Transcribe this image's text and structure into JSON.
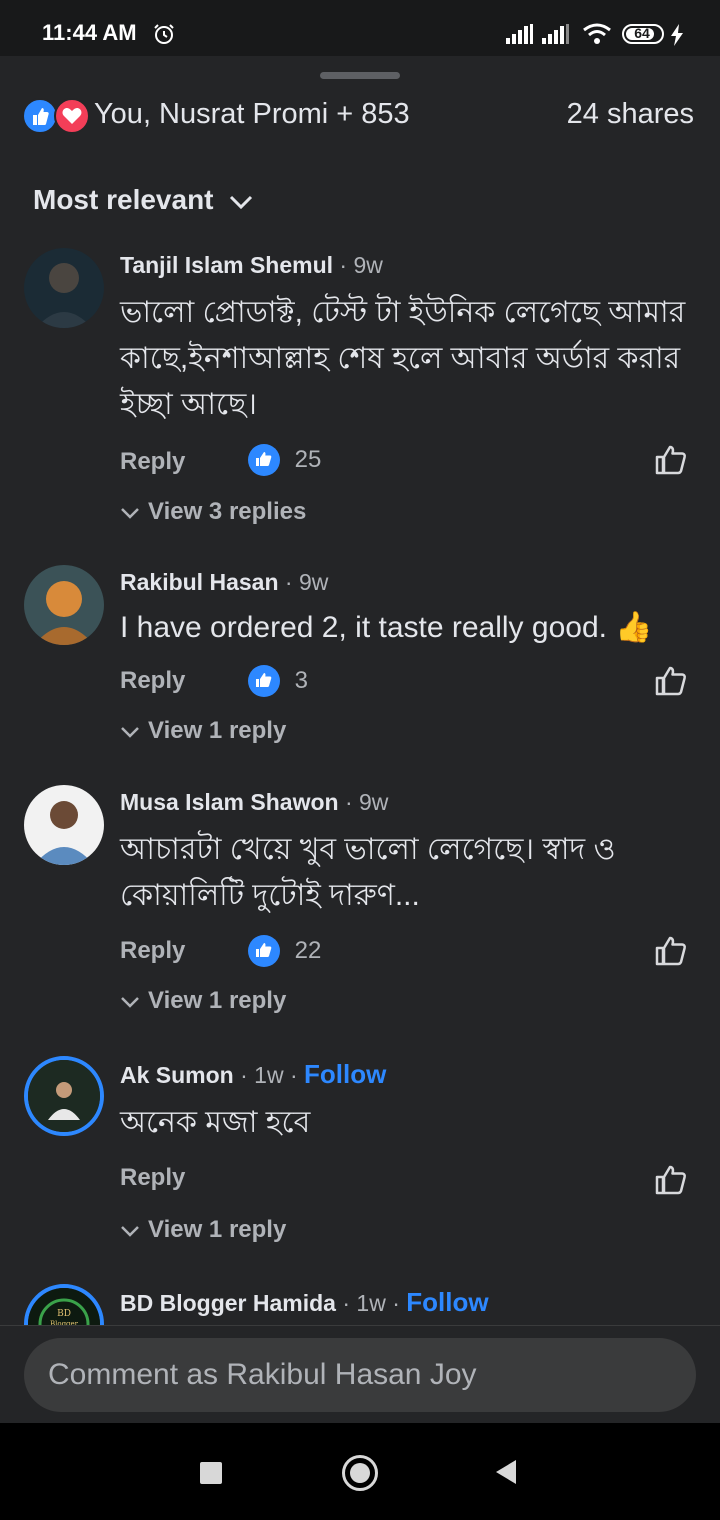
{
  "status_bar": {
    "time": "11:44 AM",
    "battery": "64",
    "icons": [
      "alarm-icon",
      "signal-icon",
      "signal-icon",
      "wifi-icon",
      "battery-icon",
      "charging-icon"
    ]
  },
  "reactions": {
    "text": "You, Nusrat Promi + 853",
    "shares": "24 shares",
    "icons": [
      "like-reaction-icon",
      "love-reaction-icon"
    ]
  },
  "sort": {
    "label": "Most relevant"
  },
  "comments": [
    {
      "name": "Tanjil Islam Shemul",
      "time": "· 9w",
      "text": "ভালো প্রোডাক্ট, টেস্ট টা ইউনিক লেগেছে আমার কাছে,ইনশাআল্লাহ শেষ হলে আবার অর্ডার করার ইচ্ছা আছে।",
      "reply_label": "Reply",
      "likes": "25",
      "view_replies": "View 3 replies"
    },
    {
      "name": "Rakibul Hasan",
      "time": "· 9w",
      "text": "I have ordered 2, it taste really good. 👍",
      "reply_label": "Reply",
      "likes": "3",
      "view_replies": "View 1 reply"
    },
    {
      "name": "Musa Islam Shawon",
      "time": "· 9w",
      "text": "আচারটা খেয়ে খুব ভালো লেগেছে। স্বাদ ও কোয়ালিটি দুটোই দারুণ...",
      "reply_label": "Reply",
      "likes": "22",
      "view_replies": "View 1 reply"
    },
    {
      "name": "Ak Sumon",
      "time": "· 1w ·",
      "follow": "Follow",
      "text": "অনেক মজা হবে",
      "reply_label": "Reply",
      "view_replies": "View 1 reply"
    },
    {
      "name": "BD Blogger Hamida",
      "time": "· 1w ·",
      "follow": "Follow",
      "avatar_text": "BD Blogger"
    }
  ],
  "composer": {
    "placeholder": "Comment as Rakibul Hasan Joy"
  },
  "nav": {
    "icons": [
      "recents-square-icon",
      "home-circle-icon",
      "back-triangle-icon"
    ]
  },
  "colors": {
    "background": "#242527",
    "accent": "#2d88ff",
    "love": "#f33e58"
  }
}
